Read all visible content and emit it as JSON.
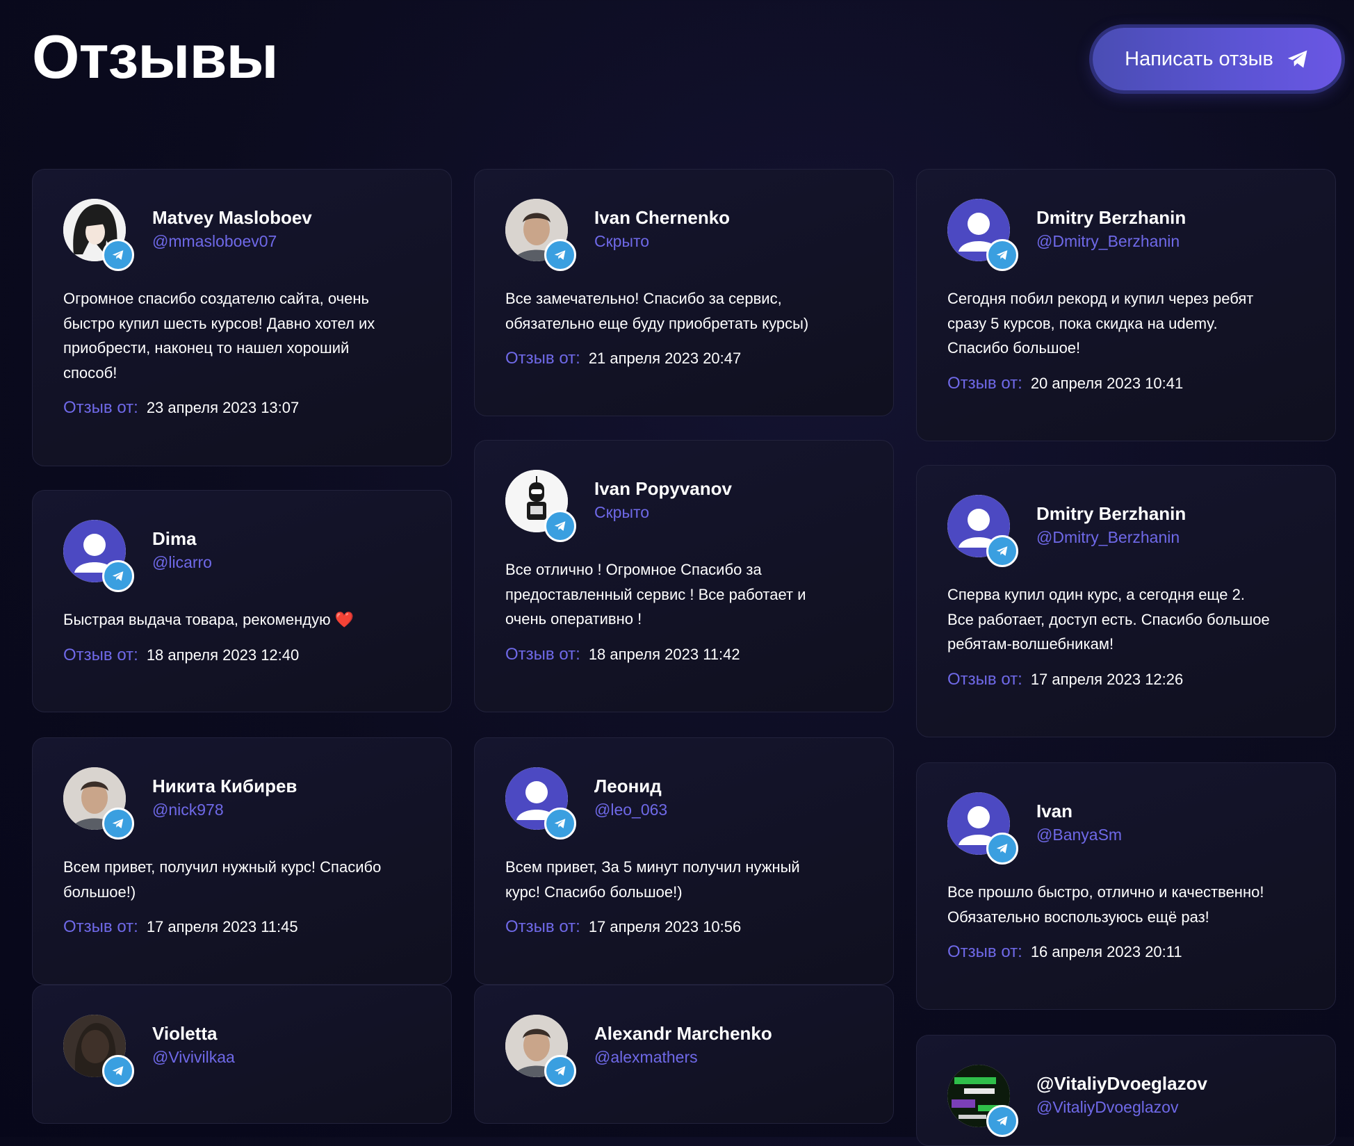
{
  "page": {
    "title": "Отзывы",
    "write_button": "Написать отзыв",
    "review_label": "Отзыв от:"
  },
  "colors": {
    "background": "#0b0b1e",
    "card": "#13132a",
    "accent": "#6f69e8",
    "button": "#5c54d4",
    "telegram": "#3a9fe0"
  },
  "columns": [
    [
      {
        "name": "Matvey Masloboev",
        "handle": "@mmasloboev07",
        "avatar": "photo-anime",
        "text": "Огромное спасибо создателю сайта, очень\nбыстро купил шесть курсов! Давно хотел их\nприобрести, наконец то нашел хороший\nспособ!",
        "date": "23 апреля 2023 13:07"
      },
      {
        "name": "Dima",
        "handle": "@licarro",
        "avatar": "default-user",
        "text": "Быстрая выдача товара, рекомендую ❤️",
        "date": "18 апреля 2023 12:40"
      },
      {
        "name": "Никита Кибирев",
        "handle": "@nick978",
        "avatar": "photo-face",
        "text": "Всем привет, получил нужный курс! Спасибо\nбольшое!)",
        "date": "17 апреля 2023 11:45"
      },
      {
        "name": "Violetta",
        "handle": "@Vivivilkaa",
        "avatar": "photo-dark",
        "text": "",
        "date": ""
      }
    ],
    [
      {
        "name": "Ivan Chernenko",
        "handle": "Скрыто",
        "avatar": "photo-face",
        "text": "Все замечательно! Спасибо за сервис,\nобязательно еще буду приобретать курсы)",
        "date": "21 апреля 2023 20:47"
      },
      {
        "name": "Ivan Popyvanov",
        "handle": "Скрыто",
        "avatar": "photo-robot",
        "text": "Все отлично ! Огромное Спасибо за\nпредоставленный сервис ! Все работает и\nочень оперативно !",
        "date": "18 апреля 2023 11:42"
      },
      {
        "name": "Леонид",
        "handle": "@leo_063",
        "avatar": "default-user",
        "text": "Всем привет, За 5 минут получил нужный\nкурс! Спасибо большое!)",
        "date": "17 апреля 2023 10:56"
      },
      {
        "name": "Alexandr Marchenko",
        "handle": "@alexmathers",
        "avatar": "photo-face",
        "text": "",
        "date": ""
      }
    ],
    [
      {
        "name": "Dmitry Berzhanin",
        "handle": "@Dmitry_Berzhanin",
        "avatar": "default-user",
        "text": "Сегодня побил рекорд и купил через ребят\nсразу 5 курсов, пока скидка на udemy.\nСпасибо большое!",
        "date": "20 апреля 2023 10:41"
      },
      {
        "name": "Dmitry Berzhanin",
        "handle": "@Dmitry_Berzhanin",
        "avatar": "default-user",
        "text": "Сперва купил один курс, а сегодня еще 2.\nВсе работает, доступ есть. Спасибо большое\nребятам-волшебникам!",
        "date": "17 апреля 2023 12:26"
      },
      {
        "name": "Ivan",
        "handle": "@BanyaSm",
        "avatar": "default-user",
        "text": "Все прошло быстро, отлично и качественно!\nОбязательно воспользуюсь ещё раз!",
        "date": "16 апреля 2023 20:11"
      },
      {
        "name": "@VitaliyDvoeglazov",
        "handle": "@VitaliyDvoeglazov",
        "avatar": "photo-glitch",
        "text": "",
        "date": ""
      }
    ]
  ]
}
